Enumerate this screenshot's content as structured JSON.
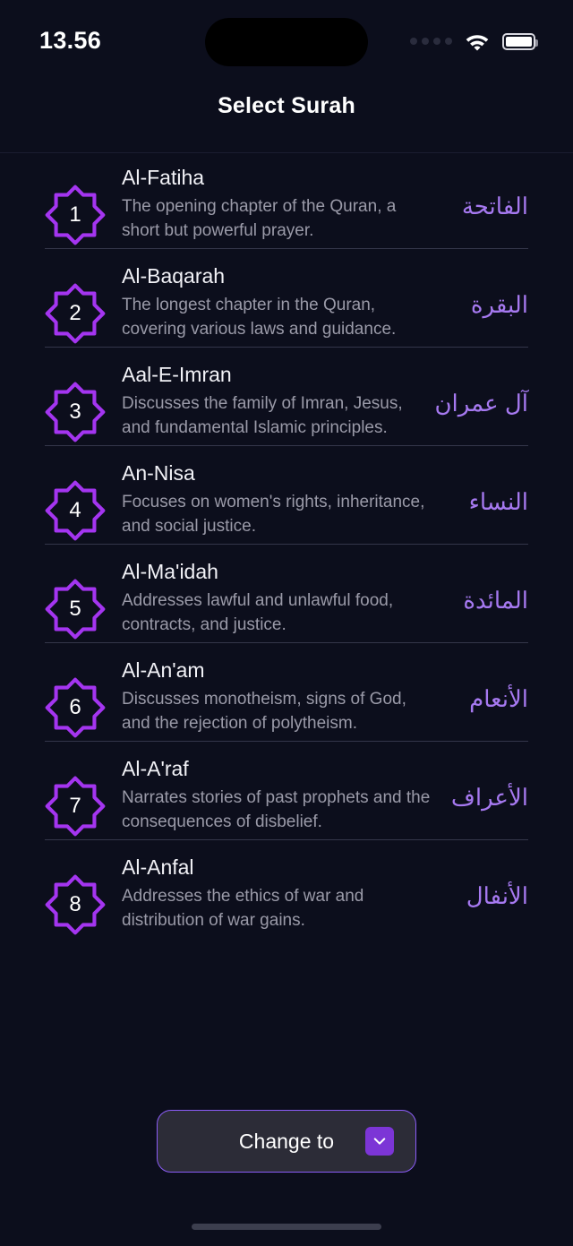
{
  "status_bar": {
    "time": "13.56",
    "signal_icon": "signal-dots-icon",
    "wifi_icon": "wifi-icon",
    "battery_icon": "battery-icon"
  },
  "header": {
    "title": "Select Surah"
  },
  "colors": {
    "background": "#0c0e1c",
    "accent_purple": "#a435f0",
    "arabic_text": "#a679f0",
    "title_text": "#f2f2f7",
    "description_text": "#9a9aa8",
    "divider": "#34364a",
    "button_fill": "#2c2c37",
    "button_border": "#8b5cf6",
    "chevron_box": "#7c35d6"
  },
  "list": {
    "items": [
      {
        "number": "1",
        "title": "Al-Fatiha",
        "description": "The opening chapter of the Quran, a short but powerful prayer.",
        "arabic": "الفاتحة"
      },
      {
        "number": "2",
        "title": "Al-Baqarah",
        "description": "The longest chapter in the Quran, covering various laws and guidance.",
        "arabic": "البقرة"
      },
      {
        "number": "3",
        "title": "Aal-E-Imran",
        "description": "Discusses the family of Imran, Jesus, and fundamental Islamic principles.",
        "arabic": "آل عمران"
      },
      {
        "number": "4",
        "title": "An-Nisa",
        "description": "Focuses on women's rights, inheritance, and social justice.",
        "arabic": "النساء"
      },
      {
        "number": "5",
        "title": "Al-Ma'idah",
        "description": "Addresses lawful and unlawful food, contracts, and justice.",
        "arabic": "المائدة"
      },
      {
        "number": "6",
        "title": "Al-An'am",
        "description": "Discusses monotheism, signs of God, and the rejection of polytheism.",
        "arabic": "الأنعام"
      },
      {
        "number": "7",
        "title": "Al-A'raf",
        "description": "Narrates stories of past prophets and the consequences of disbelief.",
        "arabic": "الأعراف"
      },
      {
        "number": "8",
        "title": "Al-Anfal",
        "description": "Addresses the ethics of war and distribution of war gains.",
        "arabic": "الأنفال"
      }
    ]
  },
  "bottom": {
    "change_label": "Change to",
    "chevron_icon": "chevron-down-icon",
    "home_indicator": "home-indicator"
  }
}
